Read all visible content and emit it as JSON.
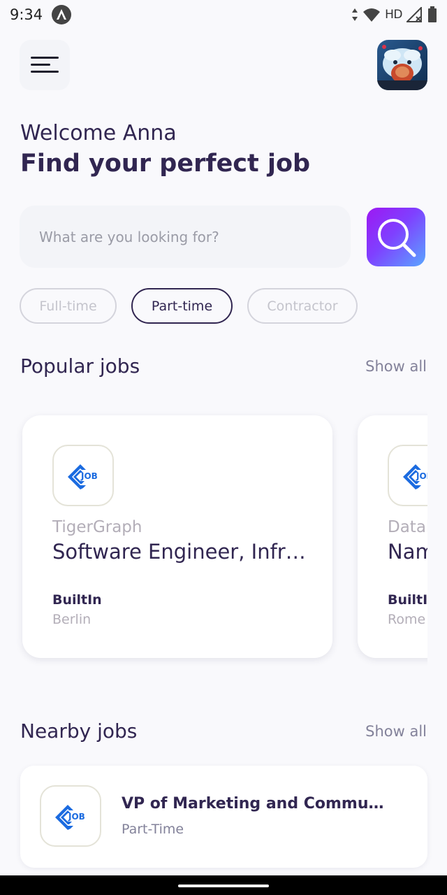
{
  "status_bar": {
    "time": "9:34",
    "network": "HD",
    "icons": [
      "data-transfer-icon",
      "wifi-icon",
      "signal-icon",
      "battery-icon"
    ]
  },
  "header": {
    "menu_icon": "menu-icon",
    "avatar": "profile-avatar"
  },
  "welcome": {
    "greeting": "Welcome Anna",
    "headline": "Find your perfect job"
  },
  "search": {
    "placeholder": "What are you looking for?",
    "value": "",
    "button_icon": "search-icon"
  },
  "job_types": [
    {
      "label": "Full-time",
      "active": false
    },
    {
      "label": "Part-time",
      "active": true
    },
    {
      "label": "Contractor",
      "active": false
    }
  ],
  "popular": {
    "title": "Popular jobs",
    "show_all": "Show all",
    "cards": [
      {
        "company": "TigerGraph",
        "title": "Software Engineer, Infra...",
        "publisher": "BuiltIn",
        "location": "Berlin"
      },
      {
        "company": "Datab",
        "title": "Nam",
        "publisher": "BuiltI",
        "location": "Rome"
      }
    ]
  },
  "nearby": {
    "title": "Nearby jobs",
    "show_all": "Show all",
    "items": [
      {
        "title": "VP of Marketing and Communi...",
        "type": "Part-Time"
      }
    ]
  },
  "colors": {
    "primary": "#312651",
    "gray": "#83829a",
    "light_gray": "#b3aeb8",
    "background": "#f9f9fc",
    "search_bg": "#f3f4f8",
    "logo_blue": "#1b6be0",
    "search_gradient_start": "#9d18f2",
    "search_gradient_end": "#5aa6ff"
  }
}
